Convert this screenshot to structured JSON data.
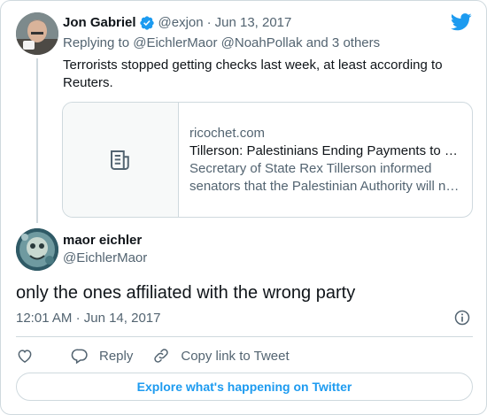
{
  "colors": {
    "brand_blue": "#1d9bf0",
    "text_primary": "#0f1419",
    "text_secondary": "#536471",
    "border": "#cfd9de"
  },
  "parent_tweet": {
    "author_name": "Jon Gabriel",
    "author_handle": "@exjon",
    "separator": "·",
    "date": "Jun 13, 2017",
    "replying_to": "Replying to @EichlerMaor @NoahPollak and 3 others",
    "text": "Terrorists stopped getting checks last week, at least according to Reuters.",
    "link_card": {
      "domain": "ricochet.com",
      "title": "Tillerson: Palestinians Ending Payments to …",
      "description": "Secretary of State Rex Tillerson informed senators that the Palestinian Authority will n…"
    }
  },
  "main_tweet": {
    "author_name": "maor eichler",
    "author_handle": "@EichlerMaor",
    "text": "only the ones affiliated with the wrong party",
    "time": "12:01 AM",
    "separator": "·",
    "date": "Jun 14, 2017"
  },
  "actions": {
    "like_icon": "heart-icon",
    "reply_label": "Reply",
    "copy_label": "Copy link to Tweet"
  },
  "explore_label": "Explore what's happening on Twitter"
}
